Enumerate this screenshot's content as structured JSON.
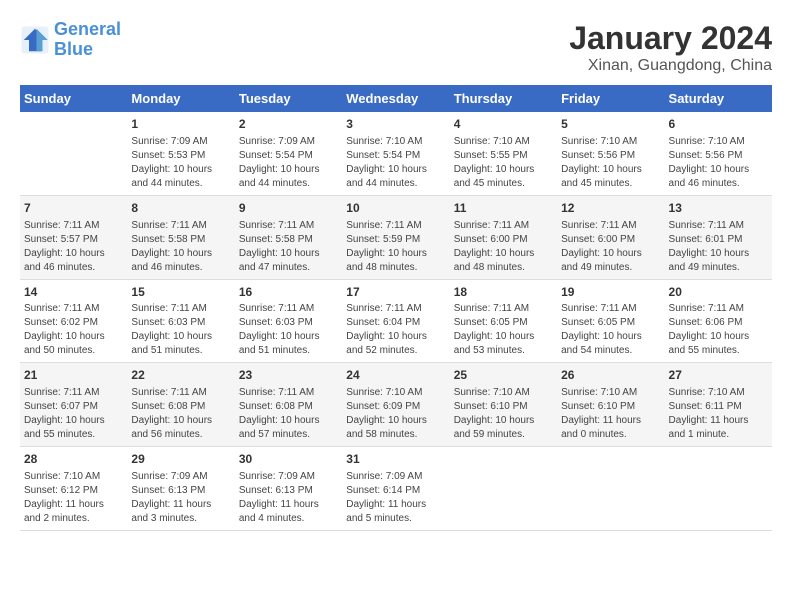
{
  "header": {
    "logo_line1": "General",
    "logo_line2": "Blue",
    "title": "January 2024",
    "subtitle": "Xinan, Guangdong, China"
  },
  "days_of_week": [
    "Sunday",
    "Monday",
    "Tuesday",
    "Wednesday",
    "Thursday",
    "Friday",
    "Saturday"
  ],
  "weeks": [
    [
      {
        "num": "",
        "info": ""
      },
      {
        "num": "1",
        "info": "Sunrise: 7:09 AM\nSunset: 5:53 PM\nDaylight: 10 hours\nand 44 minutes."
      },
      {
        "num": "2",
        "info": "Sunrise: 7:09 AM\nSunset: 5:54 PM\nDaylight: 10 hours\nand 44 minutes."
      },
      {
        "num": "3",
        "info": "Sunrise: 7:10 AM\nSunset: 5:54 PM\nDaylight: 10 hours\nand 44 minutes."
      },
      {
        "num": "4",
        "info": "Sunrise: 7:10 AM\nSunset: 5:55 PM\nDaylight: 10 hours\nand 45 minutes."
      },
      {
        "num": "5",
        "info": "Sunrise: 7:10 AM\nSunset: 5:56 PM\nDaylight: 10 hours\nand 45 minutes."
      },
      {
        "num": "6",
        "info": "Sunrise: 7:10 AM\nSunset: 5:56 PM\nDaylight: 10 hours\nand 46 minutes."
      }
    ],
    [
      {
        "num": "7",
        "info": "Sunrise: 7:11 AM\nSunset: 5:57 PM\nDaylight: 10 hours\nand 46 minutes."
      },
      {
        "num": "8",
        "info": "Sunrise: 7:11 AM\nSunset: 5:58 PM\nDaylight: 10 hours\nand 46 minutes."
      },
      {
        "num": "9",
        "info": "Sunrise: 7:11 AM\nSunset: 5:58 PM\nDaylight: 10 hours\nand 47 minutes."
      },
      {
        "num": "10",
        "info": "Sunrise: 7:11 AM\nSunset: 5:59 PM\nDaylight: 10 hours\nand 48 minutes."
      },
      {
        "num": "11",
        "info": "Sunrise: 7:11 AM\nSunset: 6:00 PM\nDaylight: 10 hours\nand 48 minutes."
      },
      {
        "num": "12",
        "info": "Sunrise: 7:11 AM\nSunset: 6:00 PM\nDaylight: 10 hours\nand 49 minutes."
      },
      {
        "num": "13",
        "info": "Sunrise: 7:11 AM\nSunset: 6:01 PM\nDaylight: 10 hours\nand 49 minutes."
      }
    ],
    [
      {
        "num": "14",
        "info": "Sunrise: 7:11 AM\nSunset: 6:02 PM\nDaylight: 10 hours\nand 50 minutes."
      },
      {
        "num": "15",
        "info": "Sunrise: 7:11 AM\nSunset: 6:03 PM\nDaylight: 10 hours\nand 51 minutes."
      },
      {
        "num": "16",
        "info": "Sunrise: 7:11 AM\nSunset: 6:03 PM\nDaylight: 10 hours\nand 51 minutes."
      },
      {
        "num": "17",
        "info": "Sunrise: 7:11 AM\nSunset: 6:04 PM\nDaylight: 10 hours\nand 52 minutes."
      },
      {
        "num": "18",
        "info": "Sunrise: 7:11 AM\nSunset: 6:05 PM\nDaylight: 10 hours\nand 53 minutes."
      },
      {
        "num": "19",
        "info": "Sunrise: 7:11 AM\nSunset: 6:05 PM\nDaylight: 10 hours\nand 54 minutes."
      },
      {
        "num": "20",
        "info": "Sunrise: 7:11 AM\nSunset: 6:06 PM\nDaylight: 10 hours\nand 55 minutes."
      }
    ],
    [
      {
        "num": "21",
        "info": "Sunrise: 7:11 AM\nSunset: 6:07 PM\nDaylight: 10 hours\nand 55 minutes."
      },
      {
        "num": "22",
        "info": "Sunrise: 7:11 AM\nSunset: 6:08 PM\nDaylight: 10 hours\nand 56 minutes."
      },
      {
        "num": "23",
        "info": "Sunrise: 7:11 AM\nSunset: 6:08 PM\nDaylight: 10 hours\nand 57 minutes."
      },
      {
        "num": "24",
        "info": "Sunrise: 7:10 AM\nSunset: 6:09 PM\nDaylight: 10 hours\nand 58 minutes."
      },
      {
        "num": "25",
        "info": "Sunrise: 7:10 AM\nSunset: 6:10 PM\nDaylight: 10 hours\nand 59 minutes."
      },
      {
        "num": "26",
        "info": "Sunrise: 7:10 AM\nSunset: 6:10 PM\nDaylight: 11 hours\nand 0 minutes."
      },
      {
        "num": "27",
        "info": "Sunrise: 7:10 AM\nSunset: 6:11 PM\nDaylight: 11 hours\nand 1 minute."
      }
    ],
    [
      {
        "num": "28",
        "info": "Sunrise: 7:10 AM\nSunset: 6:12 PM\nDaylight: 11 hours\nand 2 minutes."
      },
      {
        "num": "29",
        "info": "Sunrise: 7:09 AM\nSunset: 6:13 PM\nDaylight: 11 hours\nand 3 minutes."
      },
      {
        "num": "30",
        "info": "Sunrise: 7:09 AM\nSunset: 6:13 PM\nDaylight: 11 hours\nand 4 minutes."
      },
      {
        "num": "31",
        "info": "Sunrise: 7:09 AM\nSunset: 6:14 PM\nDaylight: 11 hours\nand 5 minutes."
      },
      {
        "num": "",
        "info": ""
      },
      {
        "num": "",
        "info": ""
      },
      {
        "num": "",
        "info": ""
      }
    ]
  ]
}
